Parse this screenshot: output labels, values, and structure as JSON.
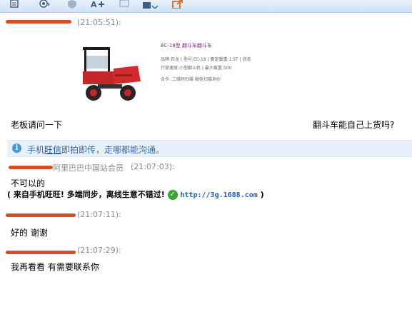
{
  "toolbar": {
    "icons": [
      "file-icon",
      "emoji-icon",
      "shield-icon",
      "add-contact-icon",
      "screen-icon",
      "upload-icon",
      "share-icon"
    ]
  },
  "messages": [
    {
      "time": "(21:05:51):"
    },
    {
      "time": "(21:07:03):",
      "sender_suffix": "阿里巴巴中国站会员",
      "line1": "不可以的",
      "line2_prefix": "( 来自手机旺旺! 多端同步，离线生意不错过! ",
      "line2_link": "http://3g.1688.com",
      "line2_suffix": " )"
    },
    {
      "time": "(21:07:11):",
      "text": "好的 谢谢"
    },
    {
      "time": "(21:07:29):",
      "text": "我再看看 有需要联系你"
    }
  ],
  "product_card": {
    "title": "EC-18型 翻斗车翻斗车",
    "line1": "品牌:巨龙  | 型号:EC-18  | 额定载重:1.5T  | 状态",
    "line2": "行驶速度:小型翻斗机  | 最大载重:500",
    "line3": "合作: 二维码扫描  微信扫描询价"
  },
  "first_message": {
    "left_text": "老板请问一下",
    "right_text": "翻斗车能自己上货吗?"
  },
  "notice": {
    "prefix": "手机",
    "link": "旺信",
    "suffix": "即拍即传，走哪都能沟通。"
  },
  "colors": {
    "redaction": "#d4502a",
    "link": "#1a5fb4",
    "check": "#3aa535"
  }
}
